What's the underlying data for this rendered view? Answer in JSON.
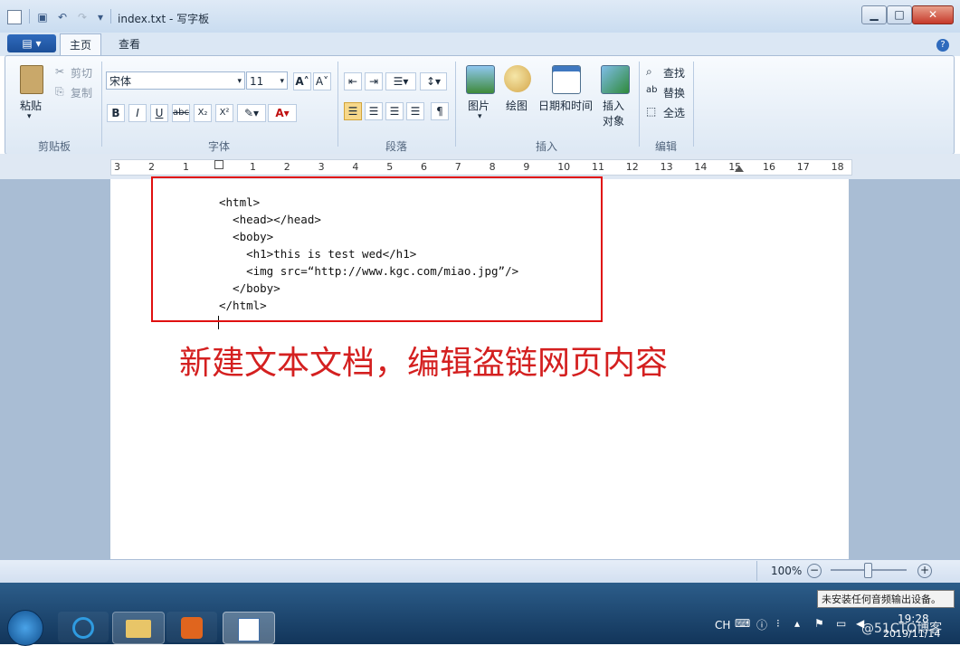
{
  "titlebar": {
    "title": "index.txt - 写字板"
  },
  "tabs": {
    "file_label": "▤ ▾",
    "home": "主页",
    "view": "查看"
  },
  "clipboard": {
    "paste": "粘贴",
    "cut": "剪切",
    "copy": "复制",
    "group": "剪贴板"
  },
  "font": {
    "family": "宋体",
    "size": "11",
    "group": "字体"
  },
  "paragraph": {
    "group": "段落"
  },
  "insert": {
    "picture": "图片",
    "paint": "绘图",
    "datetime": "日期和时间",
    "object_line1": "插入",
    "object_line2": "对象",
    "group": "插入"
  },
  "edit": {
    "find": "查找",
    "replace": "替换",
    "select_all": "全选",
    "group": "编辑"
  },
  "ruler": {
    "left_labels": [
      "3",
      "2",
      "1"
    ],
    "right_labels": [
      "1",
      "2",
      "3",
      "4",
      "5",
      "6",
      "7",
      "8",
      "9",
      "10",
      "11",
      "12",
      "13",
      "14",
      "15",
      "16",
      "17",
      "18"
    ]
  },
  "document": {
    "lines": [
      "<html>",
      "  <head></head>",
      "  <boby>",
      "    <h1>this is test wed</h1>",
      "    <img src=“http://www.kgc.com/miao.jpg”/>",
      "  </boby>",
      "</html>"
    ],
    "annotation": "新建文本文档，编辑盗链网页内容"
  },
  "status": {
    "zoom": "100%"
  },
  "tray": {
    "lang": "CH",
    "notice": "未安装任何音频输出设备。",
    "time": "19:28",
    "date": "2019/11/14",
    "watermark": "@51CTO博客"
  },
  "colors": {
    "annotation": "#d42020",
    "highlight_border": "#e01010"
  }
}
